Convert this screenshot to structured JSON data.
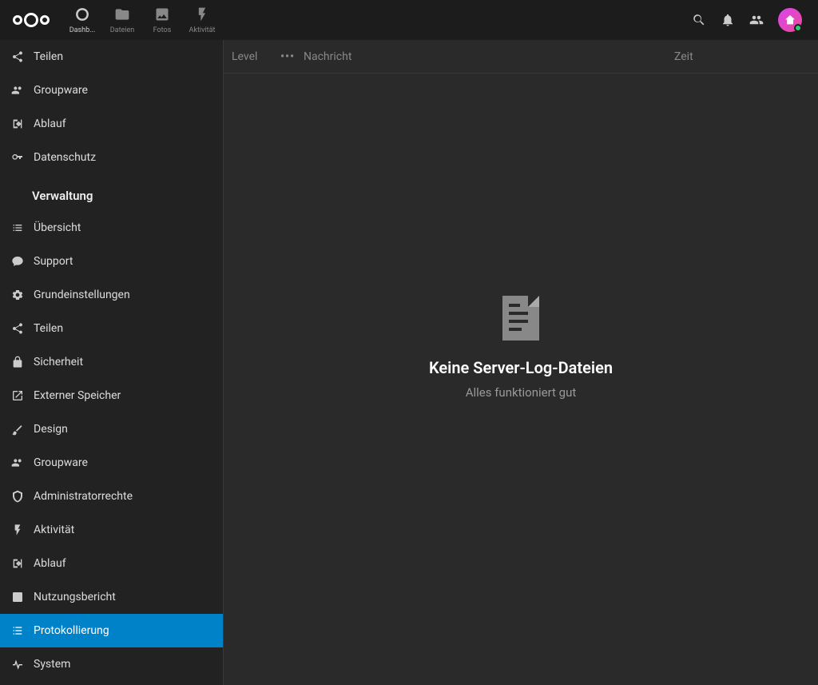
{
  "topnav": [
    {
      "label": "Dashb...",
      "icon": "circle"
    },
    {
      "label": "Dateien",
      "icon": "folder"
    },
    {
      "label": "Fotos",
      "icon": "image"
    },
    {
      "label": "Aktivität",
      "icon": "bolt"
    }
  ],
  "sidebar": {
    "group1": [
      {
        "label": "Teilen",
        "icon": "share"
      },
      {
        "label": "Groupware",
        "icon": "group"
      },
      {
        "label": "Ablauf",
        "icon": "exit"
      },
      {
        "label": "Datenschutz",
        "icon": "key"
      }
    ],
    "section_title": "Verwaltung",
    "group2": [
      {
        "label": "Übersicht",
        "icon": "list"
      },
      {
        "label": "Support",
        "icon": "comment"
      },
      {
        "label": "Grundeinstellungen",
        "icon": "gear"
      },
      {
        "label": "Teilen",
        "icon": "share"
      },
      {
        "label": "Sicherheit",
        "icon": "lock"
      },
      {
        "label": "Externer Speicher",
        "icon": "external"
      },
      {
        "label": "Design",
        "icon": "brush"
      },
      {
        "label": "Groupware",
        "icon": "group"
      },
      {
        "label": "Administratorrechte",
        "icon": "admin"
      },
      {
        "label": "Aktivität",
        "icon": "bolt"
      },
      {
        "label": "Ablauf",
        "icon": "exit"
      },
      {
        "label": "Nutzungsbericht",
        "icon": "report"
      },
      {
        "label": "Protokollierung",
        "icon": "protocol",
        "active": true
      },
      {
        "label": "System",
        "icon": "pulse"
      }
    ]
  },
  "table": {
    "level": "Level",
    "dots": "•••",
    "message": "Nachricht",
    "time": "Zeit"
  },
  "empty": {
    "title": "Keine Server-Log-Dateien",
    "sub": "Alles funktioniert gut"
  }
}
